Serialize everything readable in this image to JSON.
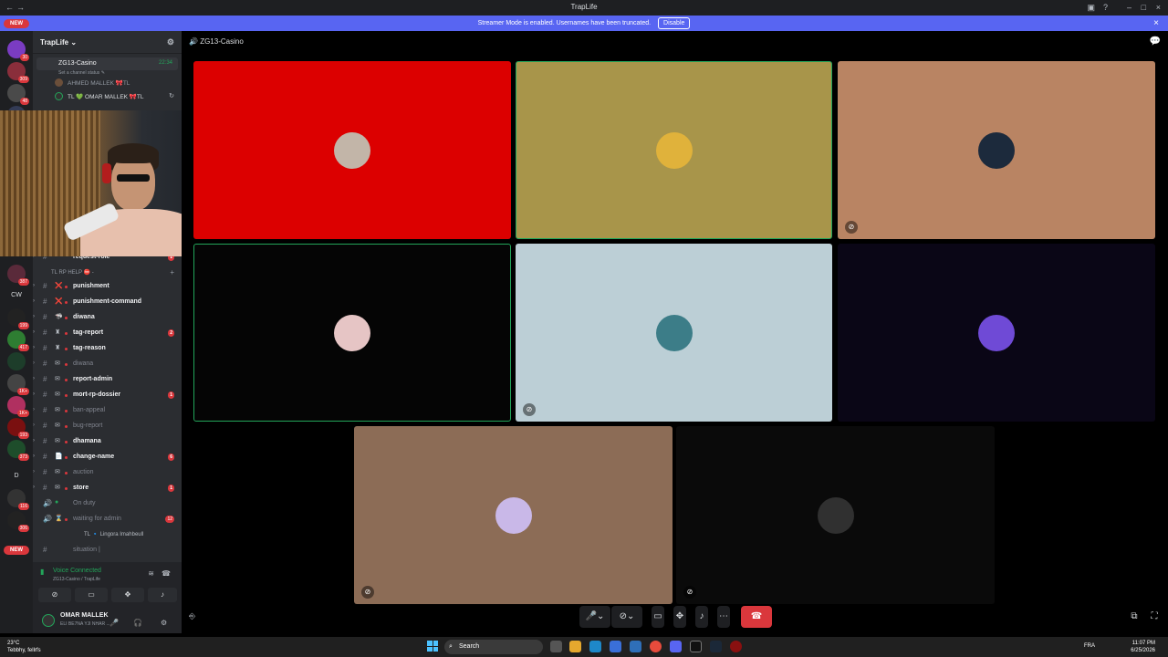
{
  "window": {
    "title": "TrapLife"
  },
  "banner": {
    "text": "Streamer Mode is enabled. Usernames have been truncated.",
    "disable_label": "Disable",
    "close": "×"
  },
  "servers": {
    "new_top": "NEW",
    "new_bottom": "NEW",
    "badges": [
      "30",
      "309",
      "48",
      "2",
      "387",
      "199",
      "417",
      "1K+",
      "1K+",
      "193",
      "373",
      "116",
      "306"
    ],
    "letters": [
      "CW",
      "D"
    ]
  },
  "guild": {
    "name": "TrapLife ⌄"
  },
  "voice_channel": {
    "name": "ZG13-Casino",
    "time": "22:34",
    "status": "Set a channel status ✎"
  },
  "voice_users": [
    {
      "name": "AHMED MALLEK 🎀TL"
    },
    {
      "name": "TL 💚 OMAR MALLEK 🎀TL"
    }
  ],
  "channel_list": {
    "partial_channel": "request-role",
    "partial_count": "1",
    "category": "TL RP HELP ⛔ -",
    "channels": [
      {
        "name": "punishment",
        "emoji": "❌",
        "muted": false,
        "count": ""
      },
      {
        "name": "punishment-command",
        "emoji": "❌",
        "muted": false,
        "count": ""
      },
      {
        "name": "diwana",
        "emoji": "🦈",
        "muted": false,
        "count": ""
      },
      {
        "name": "tag-report",
        "emoji": "♜",
        "muted": false,
        "count": "2"
      },
      {
        "name": "tag-reason",
        "emoji": "♜",
        "muted": false,
        "count": ""
      },
      {
        "name": "diwana",
        "emoji": "✉",
        "muted": true,
        "count": ""
      },
      {
        "name": "report-admin",
        "emoji": "✉",
        "muted": false,
        "count": ""
      },
      {
        "name": "mort-rp-dossier",
        "emoji": "✉",
        "muted": false,
        "count": "1"
      },
      {
        "name": "ban-appeal",
        "emoji": "✉",
        "muted": true,
        "count": ""
      },
      {
        "name": "bug-report",
        "emoji": "✉",
        "muted": true,
        "count": ""
      },
      {
        "name": "dhamana",
        "emoji": "✉",
        "muted": false,
        "count": ""
      },
      {
        "name": "change-name",
        "emoji": "📄",
        "muted": false,
        "count": "6"
      },
      {
        "name": "auction",
        "emoji": "✉",
        "muted": true,
        "count": ""
      },
      {
        "name": "store",
        "emoji": "✉",
        "muted": false,
        "count": "1"
      }
    ],
    "on_duty": "On duty",
    "waiting": {
      "name": "waiting for admin",
      "count": "12"
    },
    "waiting_user": "TL 🔹 Lingora Imahbeull",
    "partial_bottom": "situation |"
  },
  "voice_panel": {
    "state": "Voice Connected",
    "location": "ZG13-Casino / TrapLife",
    "user_name": "OMAR MALLEK",
    "user_status": "ELI BE7NA YJI NHAR ..."
  },
  "stage": {
    "channel": "ZG13-Casino"
  },
  "tiles": [
    {
      "bg": "#dc0000",
      "avatar": "#c2b5a8",
      "speaking": false,
      "muted": false
    },
    {
      "bg": "#a8954a",
      "avatar": "#e0b23b",
      "speaking": true,
      "muted": false
    },
    {
      "bg": "#b98463",
      "avatar": "#1c2a3c",
      "speaking": false,
      "muted": true
    },
    {
      "bg": "#050505",
      "avatar": "#e6c5c5",
      "speaking": true,
      "muted": false
    },
    {
      "bg": "#bccfd6",
      "avatar": "#3c7d88",
      "speaking": false,
      "muted": true
    },
    {
      "bg": "#0a0616",
      "avatar": "#6f4ad6",
      "speaking": false,
      "muted": false
    },
    {
      "bg": "#8c6c56",
      "avatar": "#c9b8e8",
      "speaking": false,
      "muted": true
    },
    {
      "bg": "#0a0a0a",
      "avatar": "#303030",
      "speaking": false,
      "muted": true
    }
  ],
  "taskbar": {
    "weather_temp": "23°C",
    "weather_desc": "Tebbhy, fellrfs",
    "search": "Search",
    "lang": "FRA",
    "time": "11:07 PM",
    "date": "6/25/2026"
  }
}
